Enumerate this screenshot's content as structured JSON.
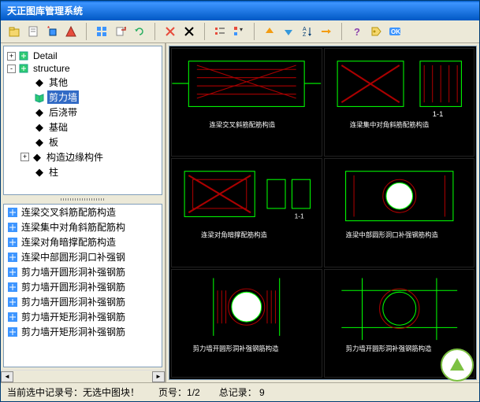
{
  "title": "天正图库管理系统",
  "tree": {
    "root1": {
      "label": "Detail",
      "expand": "+"
    },
    "root2": {
      "label": "structure",
      "expand": "-"
    },
    "children": [
      {
        "label": "其他"
      },
      {
        "label": "剪力墙",
        "selected": true
      },
      {
        "label": "后浇带"
      },
      {
        "label": "基础"
      },
      {
        "label": "板"
      },
      {
        "label": "构造边缘构件"
      },
      {
        "label": "柱"
      }
    ]
  },
  "list": [
    "连梁交叉斜筋配筋构造",
    "连梁集中对角斜筋配筋构",
    "连梁对角暗撑配筋构造",
    "连梁中部圆形洞口补强钢",
    "剪力墙开圆形洞补强钢筋",
    "剪力墙开圆形洞补强钢筋",
    "剪力墙开圆形洞补强钢筋",
    "剪力墙开矩形洞补强钢筋",
    "剪力墙开矩形洞补强钢筋"
  ],
  "status": {
    "selected": "当前选中记录号：无选中图块！",
    "page": "页号：1/2",
    "total": "总记录：  9"
  },
  "chart_data": null
}
